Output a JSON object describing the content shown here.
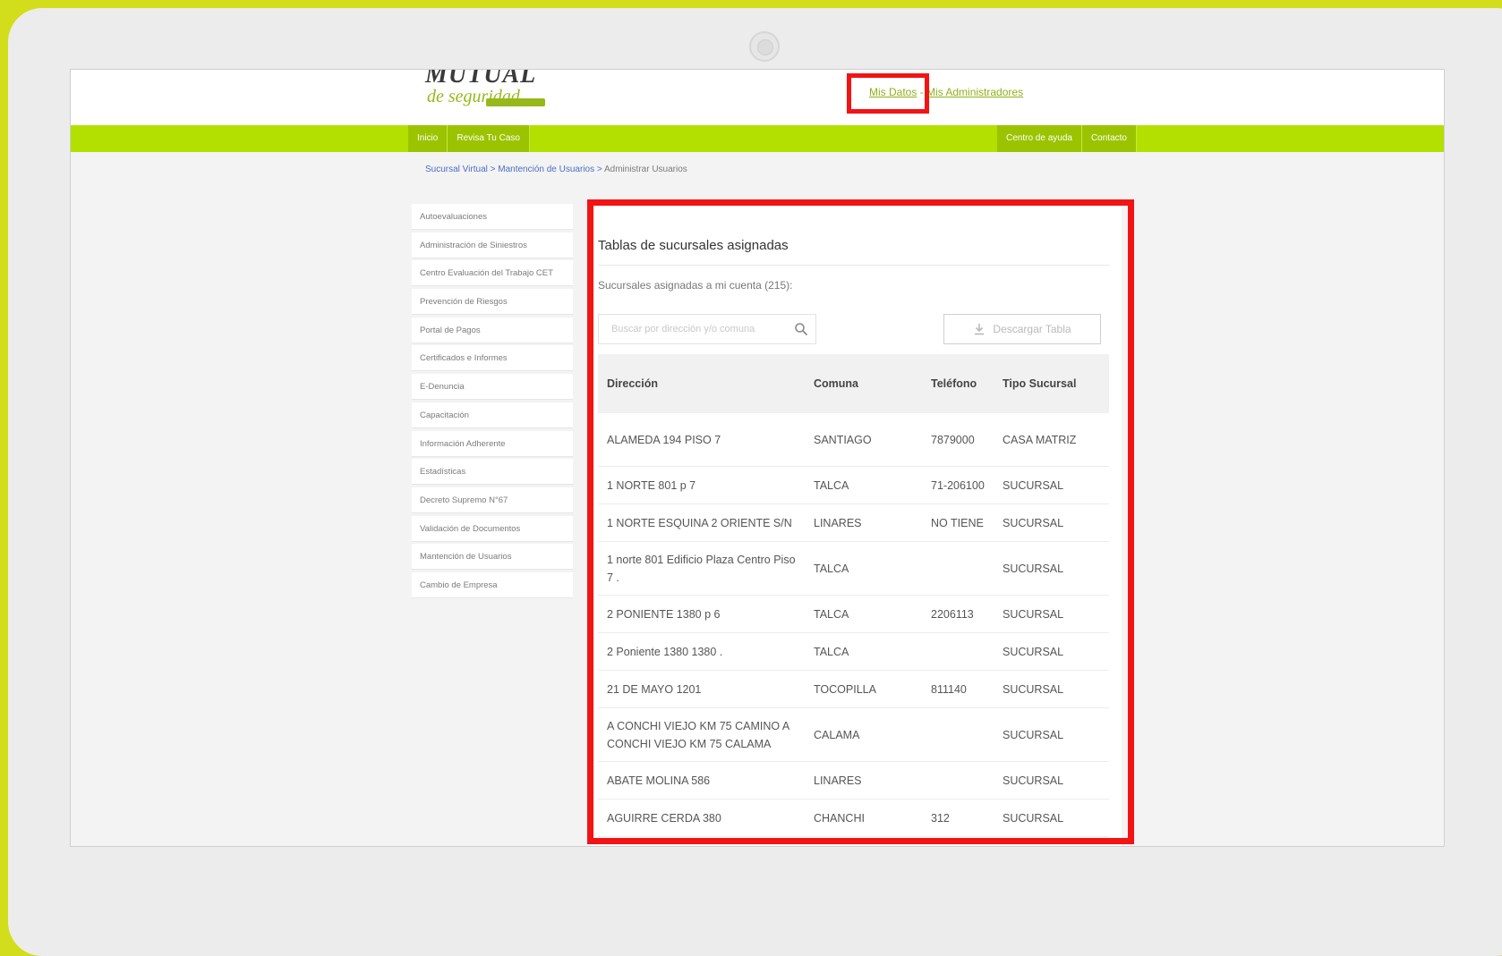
{
  "header": {
    "logo_top": "MUTUAL",
    "logo_bottom": "de seguridad",
    "links": [
      "Mis Datos",
      "Mis Administradores"
    ],
    "separator": "-"
  },
  "nav": {
    "left": [
      "Inicio",
      "Revisa Tu Caso"
    ],
    "right": [
      "Centro de ayuda",
      "Contacto"
    ]
  },
  "breadcrumb": {
    "items": [
      "Sucursal Virtual",
      "Mantención de Usuarios"
    ],
    "current": "Administrar Usuarios",
    "separator": ">"
  },
  "sidebar": {
    "items": [
      "Autoevaluaciones",
      "Administración de Siniestros",
      "Centro Evaluación del Trabajo CET",
      "Prevención de Riesgos",
      "Portal de Pagos",
      "Certificados e Informes",
      "E-Denuncia",
      "Capacitación",
      "Información Adherente",
      "Estadísticas",
      "Decreto Supremo N°67",
      "Validación de Documentos",
      "Mantención de Usuarios",
      "Cambio de Empresa"
    ]
  },
  "panel": {
    "title": "Tablas de sucursales asignadas",
    "subtitle": "Sucursales asignadas a mi cuenta (215):",
    "search_placeholder": "Buscar por dirección y/o comuna",
    "download_label": "Descargar Tabla"
  },
  "table": {
    "headers": [
      "Dirección",
      "Comuna",
      "Teléfono",
      "Tipo Sucursal"
    ],
    "rows": [
      [
        "ALAMEDA 194 PISO 7",
        "SANTIAGO",
        "7879000",
        "CASA MATRIZ"
      ],
      [
        "1 NORTE 801 p 7",
        "TALCA",
        "71-206100",
        "SUCURSAL"
      ],
      [
        "1 NORTE ESQUINA 2 ORIENTE S/N",
        "LINARES",
        "NO TIENE",
        "SUCURSAL"
      ],
      [
        "1 norte 801 Edificio Plaza Centro Piso 7 .",
        "TALCA",
        "",
        "SUCURSAL"
      ],
      [
        "2 PONIENTE 1380 p 6",
        "TALCA",
        "2206113",
        "SUCURSAL"
      ],
      [
        "2 Poniente 1380 1380 .",
        "TALCA",
        "",
        "SUCURSAL"
      ],
      [
        "21 DE MAYO 1201",
        "TOCOPILLA",
        "811140",
        "SUCURSAL"
      ],
      [
        "A CONCHI VIEJO KM 75 CAMINO A CONCHI VIEJO KM 75 CALAMA",
        "CALAMA",
        "",
        "SUCURSAL"
      ],
      [
        "ABATE MOLINA 586",
        "LINARES",
        "",
        "SUCURSAL"
      ],
      [
        "AGUIRRE CERDA 380",
        "CHANCHI",
        "312",
        "SUCURSAL"
      ]
    ]
  },
  "colors": {
    "frame": "#d2dd1b",
    "nav_green": "#b4e000",
    "highlight": "#f21414",
    "link": "#8fb01a"
  }
}
